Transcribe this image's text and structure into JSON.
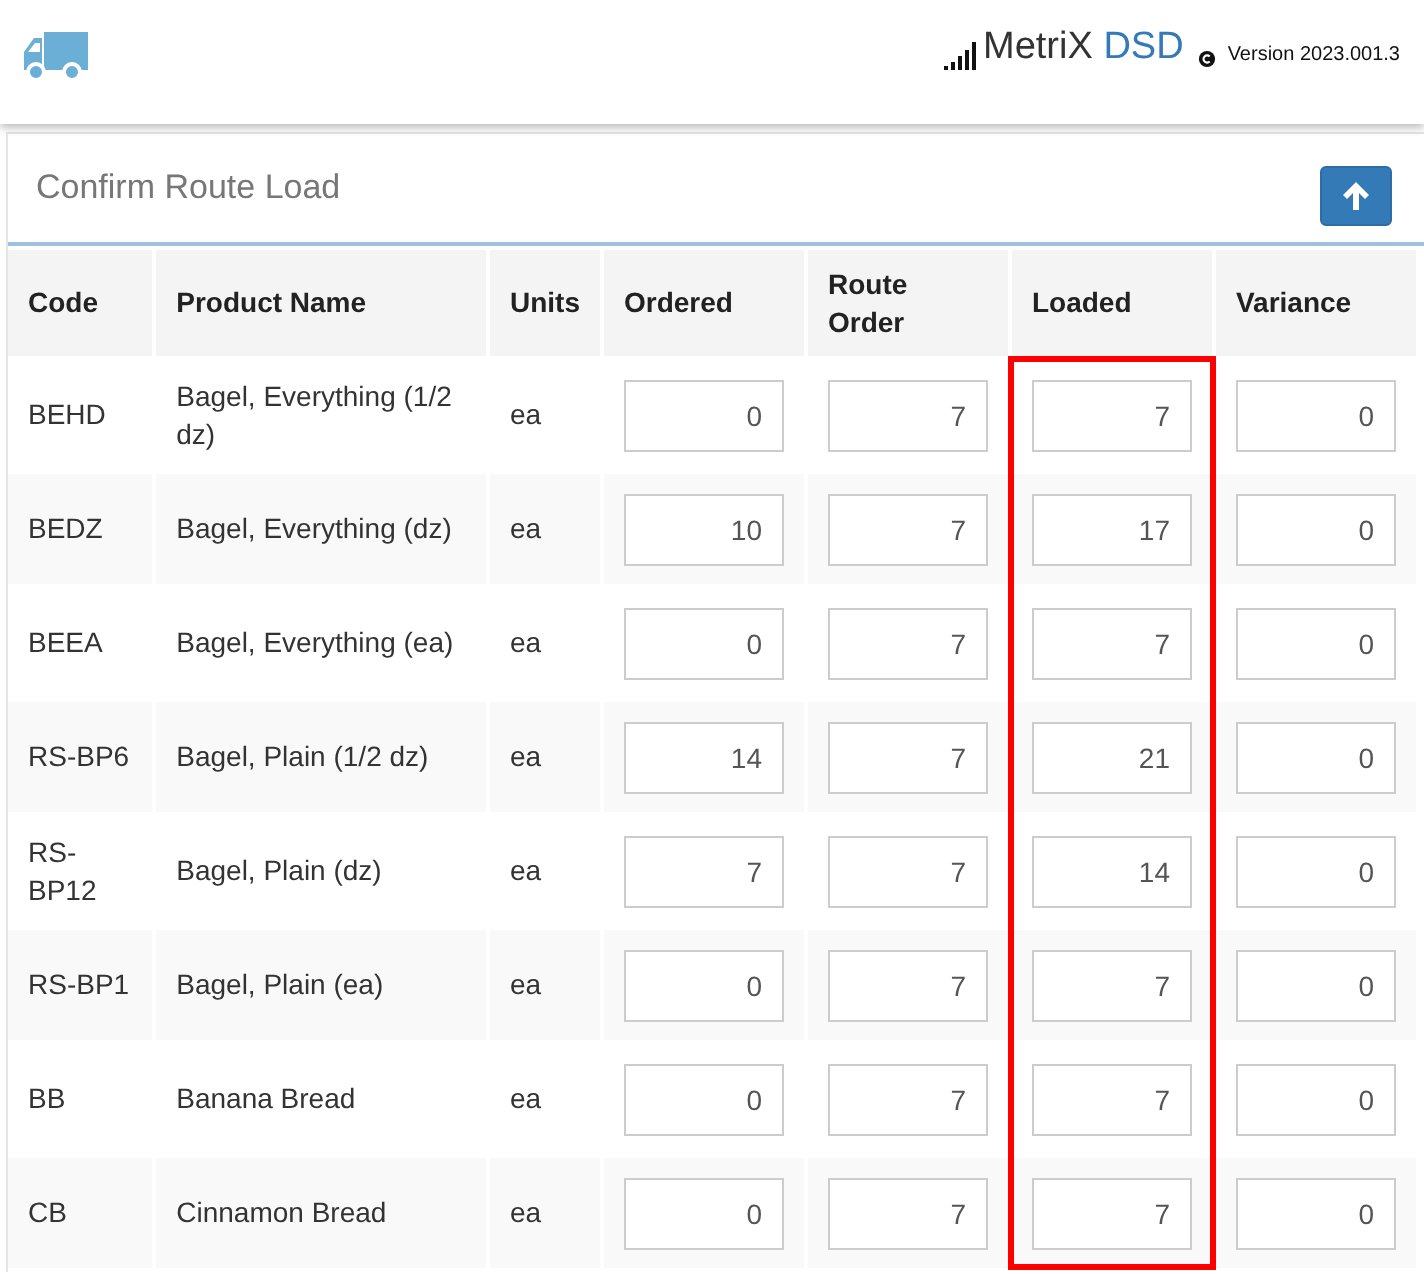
{
  "header": {
    "brand": "MetriX",
    "brand_accent": "DSD",
    "version": "Version 2023.001.3"
  },
  "panel": {
    "title": "Confirm Route Load"
  },
  "table": {
    "columns": [
      {
        "label": "Code",
        "highlighted": false
      },
      {
        "label": "Product Name",
        "highlighted": false
      },
      {
        "label": "Units",
        "highlighted": false
      },
      {
        "label": "Ordered",
        "highlighted": false
      },
      {
        "label": "Route Order",
        "highlighted": false
      },
      {
        "label": "Loaded",
        "highlighted": true
      },
      {
        "label": "Variance",
        "highlighted": false
      }
    ],
    "rows": [
      {
        "code": "BEHD",
        "name": "Bagel, Everything (1/2 dz)",
        "units": "ea",
        "ordered": "0",
        "route_order": "7",
        "loaded": "7",
        "variance": "0"
      },
      {
        "code": "BEDZ",
        "name": "Bagel, Everything (dz)",
        "units": "ea",
        "ordered": "10",
        "route_order": "7",
        "loaded": "17",
        "variance": "0"
      },
      {
        "code": "BEEA",
        "name": "Bagel, Everything (ea)",
        "units": "ea",
        "ordered": "0",
        "route_order": "7",
        "loaded": "7",
        "variance": "0"
      },
      {
        "code": "RS-BP6",
        "name": "Bagel, Plain (1/2 dz)",
        "units": "ea",
        "ordered": "14",
        "route_order": "7",
        "loaded": "21",
        "variance": "0"
      },
      {
        "code": "RS-BP12",
        "name": "Bagel, Plain (dz)",
        "units": "ea",
        "ordered": "7",
        "route_order": "7",
        "loaded": "14",
        "variance": "0"
      },
      {
        "code": "RS-BP1",
        "name": "Bagel, Plain (ea)",
        "units": "ea",
        "ordered": "0",
        "route_order": "7",
        "loaded": "7",
        "variance": "0"
      },
      {
        "code": "BB",
        "name": "Banana Bread",
        "units": "ea",
        "ordered": "0",
        "route_order": "7",
        "loaded": "7",
        "variance": "0"
      },
      {
        "code": "CB",
        "name": "Cinnamon Bread",
        "units": "ea",
        "ordered": "0",
        "route_order": "7",
        "loaded": "7",
        "variance": "0"
      }
    ]
  }
}
